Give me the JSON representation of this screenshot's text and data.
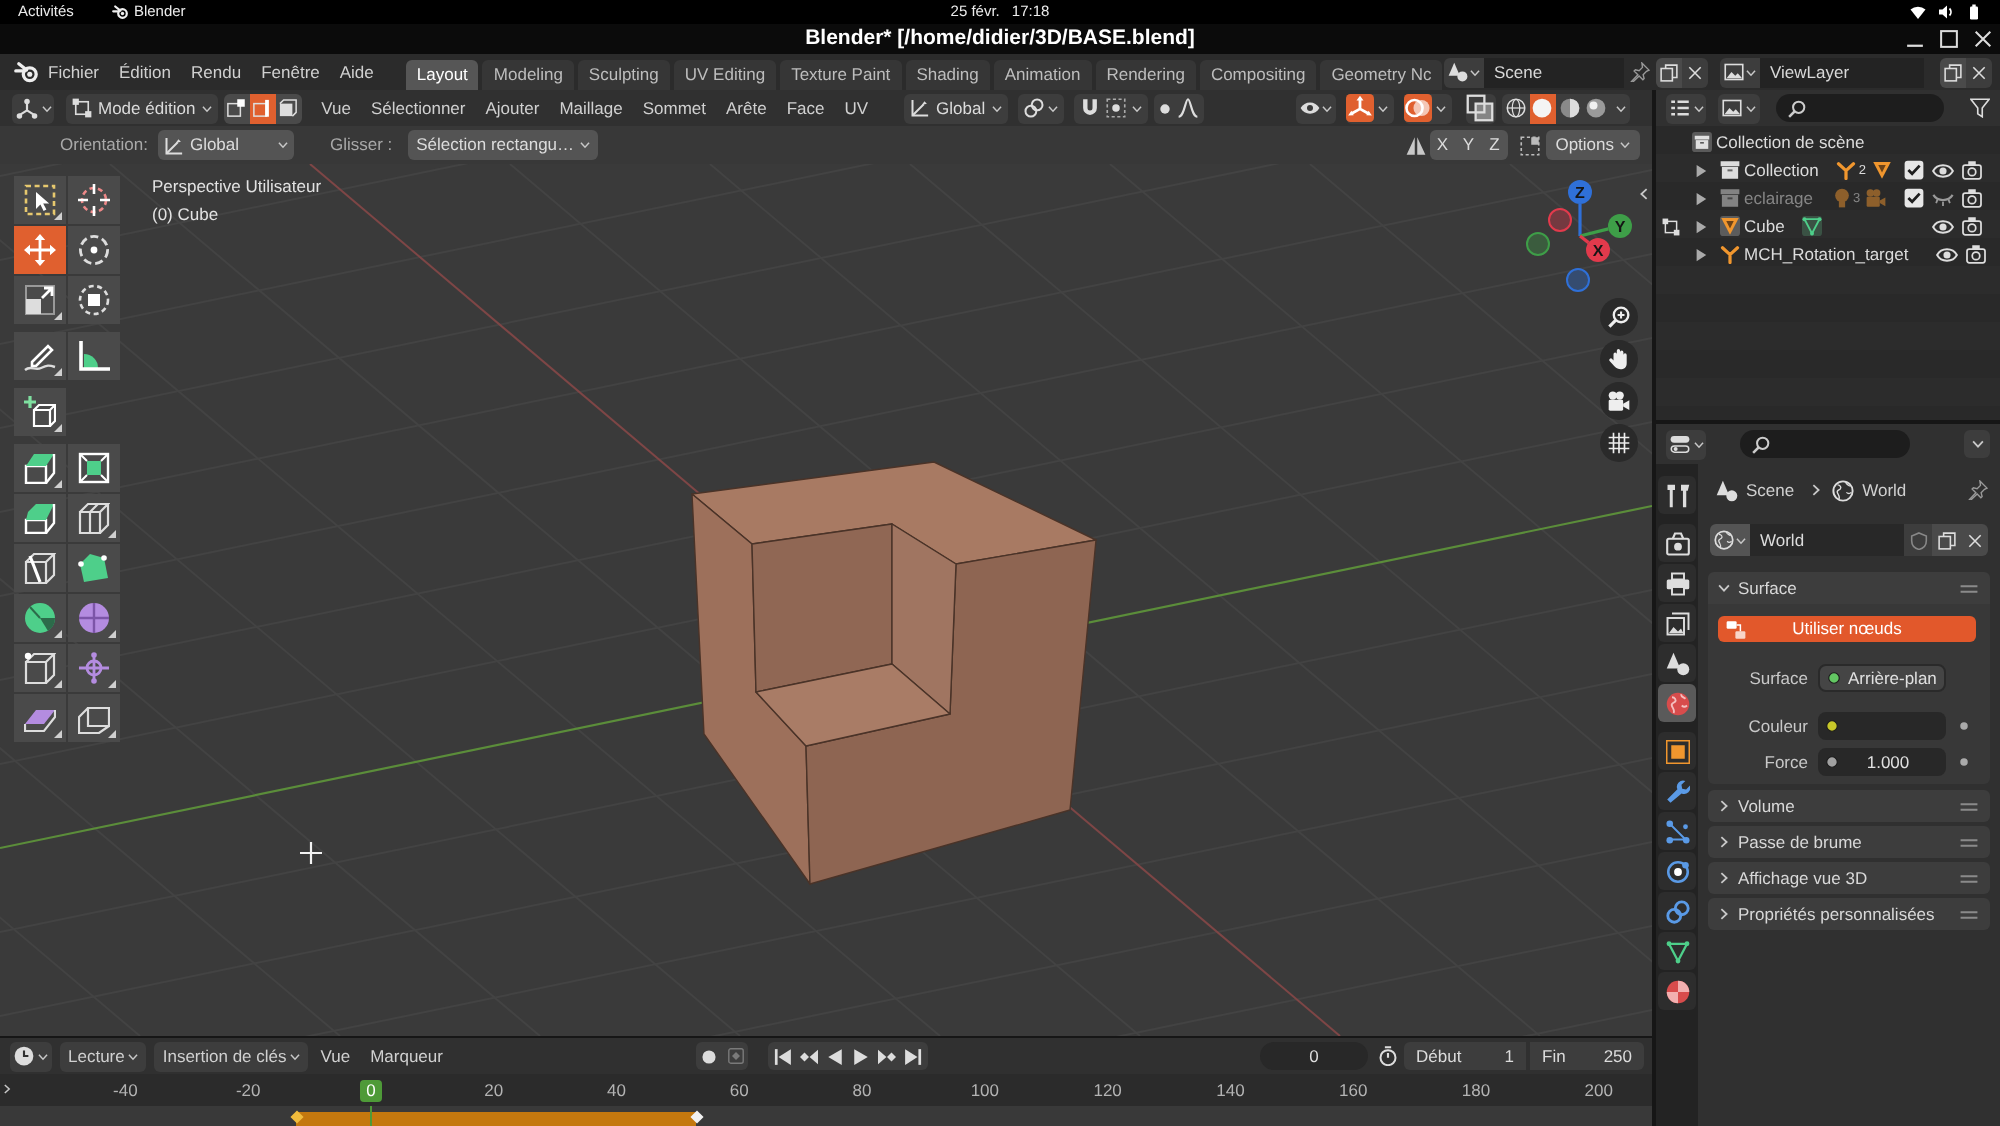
{
  "system_bar": {
    "activities": "Activités",
    "app": "Blender",
    "date": "25 févr.",
    "time": "17:18"
  },
  "window": {
    "title": "Blender* [/home/didier/3D/BASE.blend]"
  },
  "topbar": {
    "menus": [
      "Fichier",
      "Édition",
      "Rendu",
      "Fenêtre",
      "Aide"
    ],
    "workspaces": [
      {
        "label": "Layout",
        "selected": true
      },
      {
        "label": "Modeling",
        "selected": false
      },
      {
        "label": "Sculpting",
        "selected": false
      },
      {
        "label": "UV Editing",
        "selected": false
      },
      {
        "label": "Texture Paint",
        "selected": false
      },
      {
        "label": "Shading",
        "selected": false
      },
      {
        "label": "Animation",
        "selected": false
      },
      {
        "label": "Rendering",
        "selected": false
      },
      {
        "label": "Compositing",
        "selected": false
      },
      {
        "label": "Geometry Nc",
        "selected": false
      }
    ],
    "scene": "Scene",
    "view_layer": "ViewLayer"
  },
  "viewport_header": {
    "mode": "Mode édition",
    "select_modes": [
      {
        "kind": "vertex",
        "selected": false
      },
      {
        "kind": "edge",
        "selected": true
      },
      {
        "kind": "face",
        "selected": false
      }
    ],
    "menus": [
      "Vue",
      "Sélectionner",
      "Ajouter",
      "Maillage",
      "Sommet",
      "Arête",
      "Face",
      "UV"
    ],
    "orientation": "Global",
    "toggles": [
      {
        "kind": "gizmos",
        "on": true
      },
      {
        "kind": "overlays",
        "on": true
      },
      {
        "kind": "xray",
        "on": false
      }
    ],
    "shading": [
      {
        "kind": "wireframe",
        "selected": false
      },
      {
        "kind": "solid",
        "selected": true
      },
      {
        "kind": "material",
        "selected": false
      },
      {
        "kind": "rendered",
        "selected": false
      }
    ]
  },
  "tool_settings": {
    "orientation_label": "Orientation:",
    "orientation": "Global",
    "drag_label": "Glisser :",
    "drag": "Sélection rectangu…",
    "mirror_axes": [
      {
        "label": "X",
        "on": false
      },
      {
        "label": "Y",
        "on": false
      },
      {
        "label": "Z",
        "on": false
      }
    ],
    "options": "Options"
  },
  "viewport": {
    "view_name": "Perspective Utilisateur",
    "object_info": "(0) Cube",
    "tool_groups": [
      [
        {
          "kind": "select_box",
          "selected": false,
          "more": true
        },
        {
          "kind": "cursor",
          "selected": false,
          "more": false
        },
        {
          "kind": "move",
          "selected": true,
          "more": false
        },
        {
          "kind": "rotate",
          "selected": false,
          "more": false
        },
        {
          "kind": "scale",
          "selected": false,
          "more": true
        },
        {
          "kind": "transform",
          "selected": false,
          "more": false
        }
      ],
      [
        {
          "kind": "annotate",
          "selected": false,
          "more": true
        },
        {
          "kind": "measure",
          "selected": false,
          "more": false
        }
      ],
      [
        {
          "kind": "add_cube",
          "selected": false,
          "more": true
        }
      ],
      [
        {
          "kind": "extrude",
          "selected": false,
          "more": true
        },
        {
          "kind": "inset",
          "selected": false,
          "more": false
        },
        {
          "kind": "bevel",
          "selected": false,
          "more": false
        },
        {
          "kind": "loop_cut",
          "selected": false,
          "more": true
        },
        {
          "kind": "knife",
          "selected": false,
          "more": false
        },
        {
          "kind": "poly_build",
          "selected": false,
          "more": false
        },
        {
          "kind": "spin",
          "selected": false,
          "more": true
        },
        {
          "kind": "smooth",
          "selected": false,
          "more": true
        },
        {
          "kind": "edge_slide",
          "selected": false,
          "more": true
        },
        {
          "kind": "shrink_fatten",
          "selected": false,
          "more": true
        },
        {
          "kind": "shear",
          "selected": false,
          "more": true
        },
        {
          "kind": "rip",
          "selected": false,
          "more": true
        }
      ]
    ],
    "gizmo_axes": [
      {
        "label": "Z",
        "color": "#2f70d8"
      },
      {
        "label": "Y",
        "color": "#3e9e48"
      },
      {
        "label": "X",
        "color": "#e23a4c"
      }
    ]
  },
  "outliner": {
    "tree": [
      {
        "label": "Collection de scène",
        "kind": "scene_collection",
        "children": [
          {
            "label": "Collection",
            "kind": "collection",
            "expanded": false,
            "included": true,
            "visible": true,
            "editing": false,
            "contents": [
              {
                "kind": "armature",
                "count": "2"
              },
              {
                "kind": "mesh"
              }
            ]
          },
          {
            "label": "eclairage",
            "kind": "collection",
            "expanded": false,
            "included": true,
            "visible": false,
            "editing": false,
            "contents": [
              {
                "kind": "light",
                "count": "3"
              },
              {
                "kind": "camera"
              }
            ]
          },
          {
            "label": "Cube",
            "kind": "mesh",
            "expanded": false,
            "visible": true,
            "editing": true,
            "contents": [
              {
                "kind": "mesh_data"
              }
            ]
          },
          {
            "label": "MCH_Rotation_target",
            "kind": "armature",
            "expanded": false,
            "visible": true,
            "editing": false
          }
        ]
      }
    ]
  },
  "properties": {
    "tabs": [
      [
        {
          "kind": "tool",
          "selected": false
        }
      ],
      [
        {
          "kind": "render",
          "selected": false
        },
        {
          "kind": "output",
          "selected": false
        },
        {
          "kind": "view_layer",
          "selected": false
        },
        {
          "kind": "scene",
          "selected": false
        },
        {
          "kind": "world",
          "selected": true
        }
      ],
      [
        {
          "kind": "object",
          "selected": false
        },
        {
          "kind": "modifiers",
          "selected": false
        },
        {
          "kind": "particles",
          "selected": false
        },
        {
          "kind": "physics",
          "selected": false
        },
        {
          "kind": "constraints",
          "selected": false
        },
        {
          "kind": "data",
          "selected": false
        },
        {
          "kind": "material",
          "selected": false
        }
      ]
    ],
    "breadcrumb": [
      {
        "label": "Scene",
        "kind": "scene"
      },
      {
        "label": "World",
        "kind": "world"
      }
    ],
    "world": "World",
    "panels": [
      {
        "title": "Surface",
        "expanded": true,
        "button": "Utiliser nœuds",
        "fields": [
          {
            "label": "Surface",
            "kind": "shader",
            "value": "Arrière-plan"
          },
          {
            "label": "Couleur",
            "kind": "color"
          },
          {
            "label": "Force",
            "kind": "float",
            "value": "1.000"
          }
        ]
      },
      {
        "title": "Volume",
        "expanded": false
      },
      {
        "title": "Passe de brume",
        "expanded": false
      },
      {
        "title": "Affichage vue 3D",
        "expanded": false
      },
      {
        "title": "Propriétés personnalisées",
        "expanded": false
      }
    ]
  },
  "timeline": {
    "menus": [
      {
        "label": "Lecture",
        "kind": "dropdown"
      },
      {
        "label": "Insertion de clés",
        "kind": "dropdown"
      },
      {
        "label": "Vue",
        "kind": "menu"
      },
      {
        "label": "Marqueur",
        "kind": "menu"
      }
    ],
    "current_frame": "0",
    "start": {
      "label": "Début",
      "value": "1"
    },
    "end": {
      "label": "Fin",
      "value": "250"
    },
    "ruler": [
      {
        "label": "-40",
        "current": false
      },
      {
        "label": "-20",
        "current": false
      },
      {
        "label": "0",
        "current": true
      },
      {
        "label": "20",
        "current": false
      },
      {
        "label": "40",
        "current": false
      },
      {
        "label": "60",
        "current": false
      },
      {
        "label": "80",
        "current": false
      },
      {
        "label": "100",
        "current": false
      },
      {
        "label": "120",
        "current": false
      },
      {
        "label": "140",
        "current": false
      },
      {
        "label": "160",
        "current": false
      },
      {
        "label": "180",
        "current": false
      },
      {
        "label": "200",
        "current": false
      }
    ]
  }
}
